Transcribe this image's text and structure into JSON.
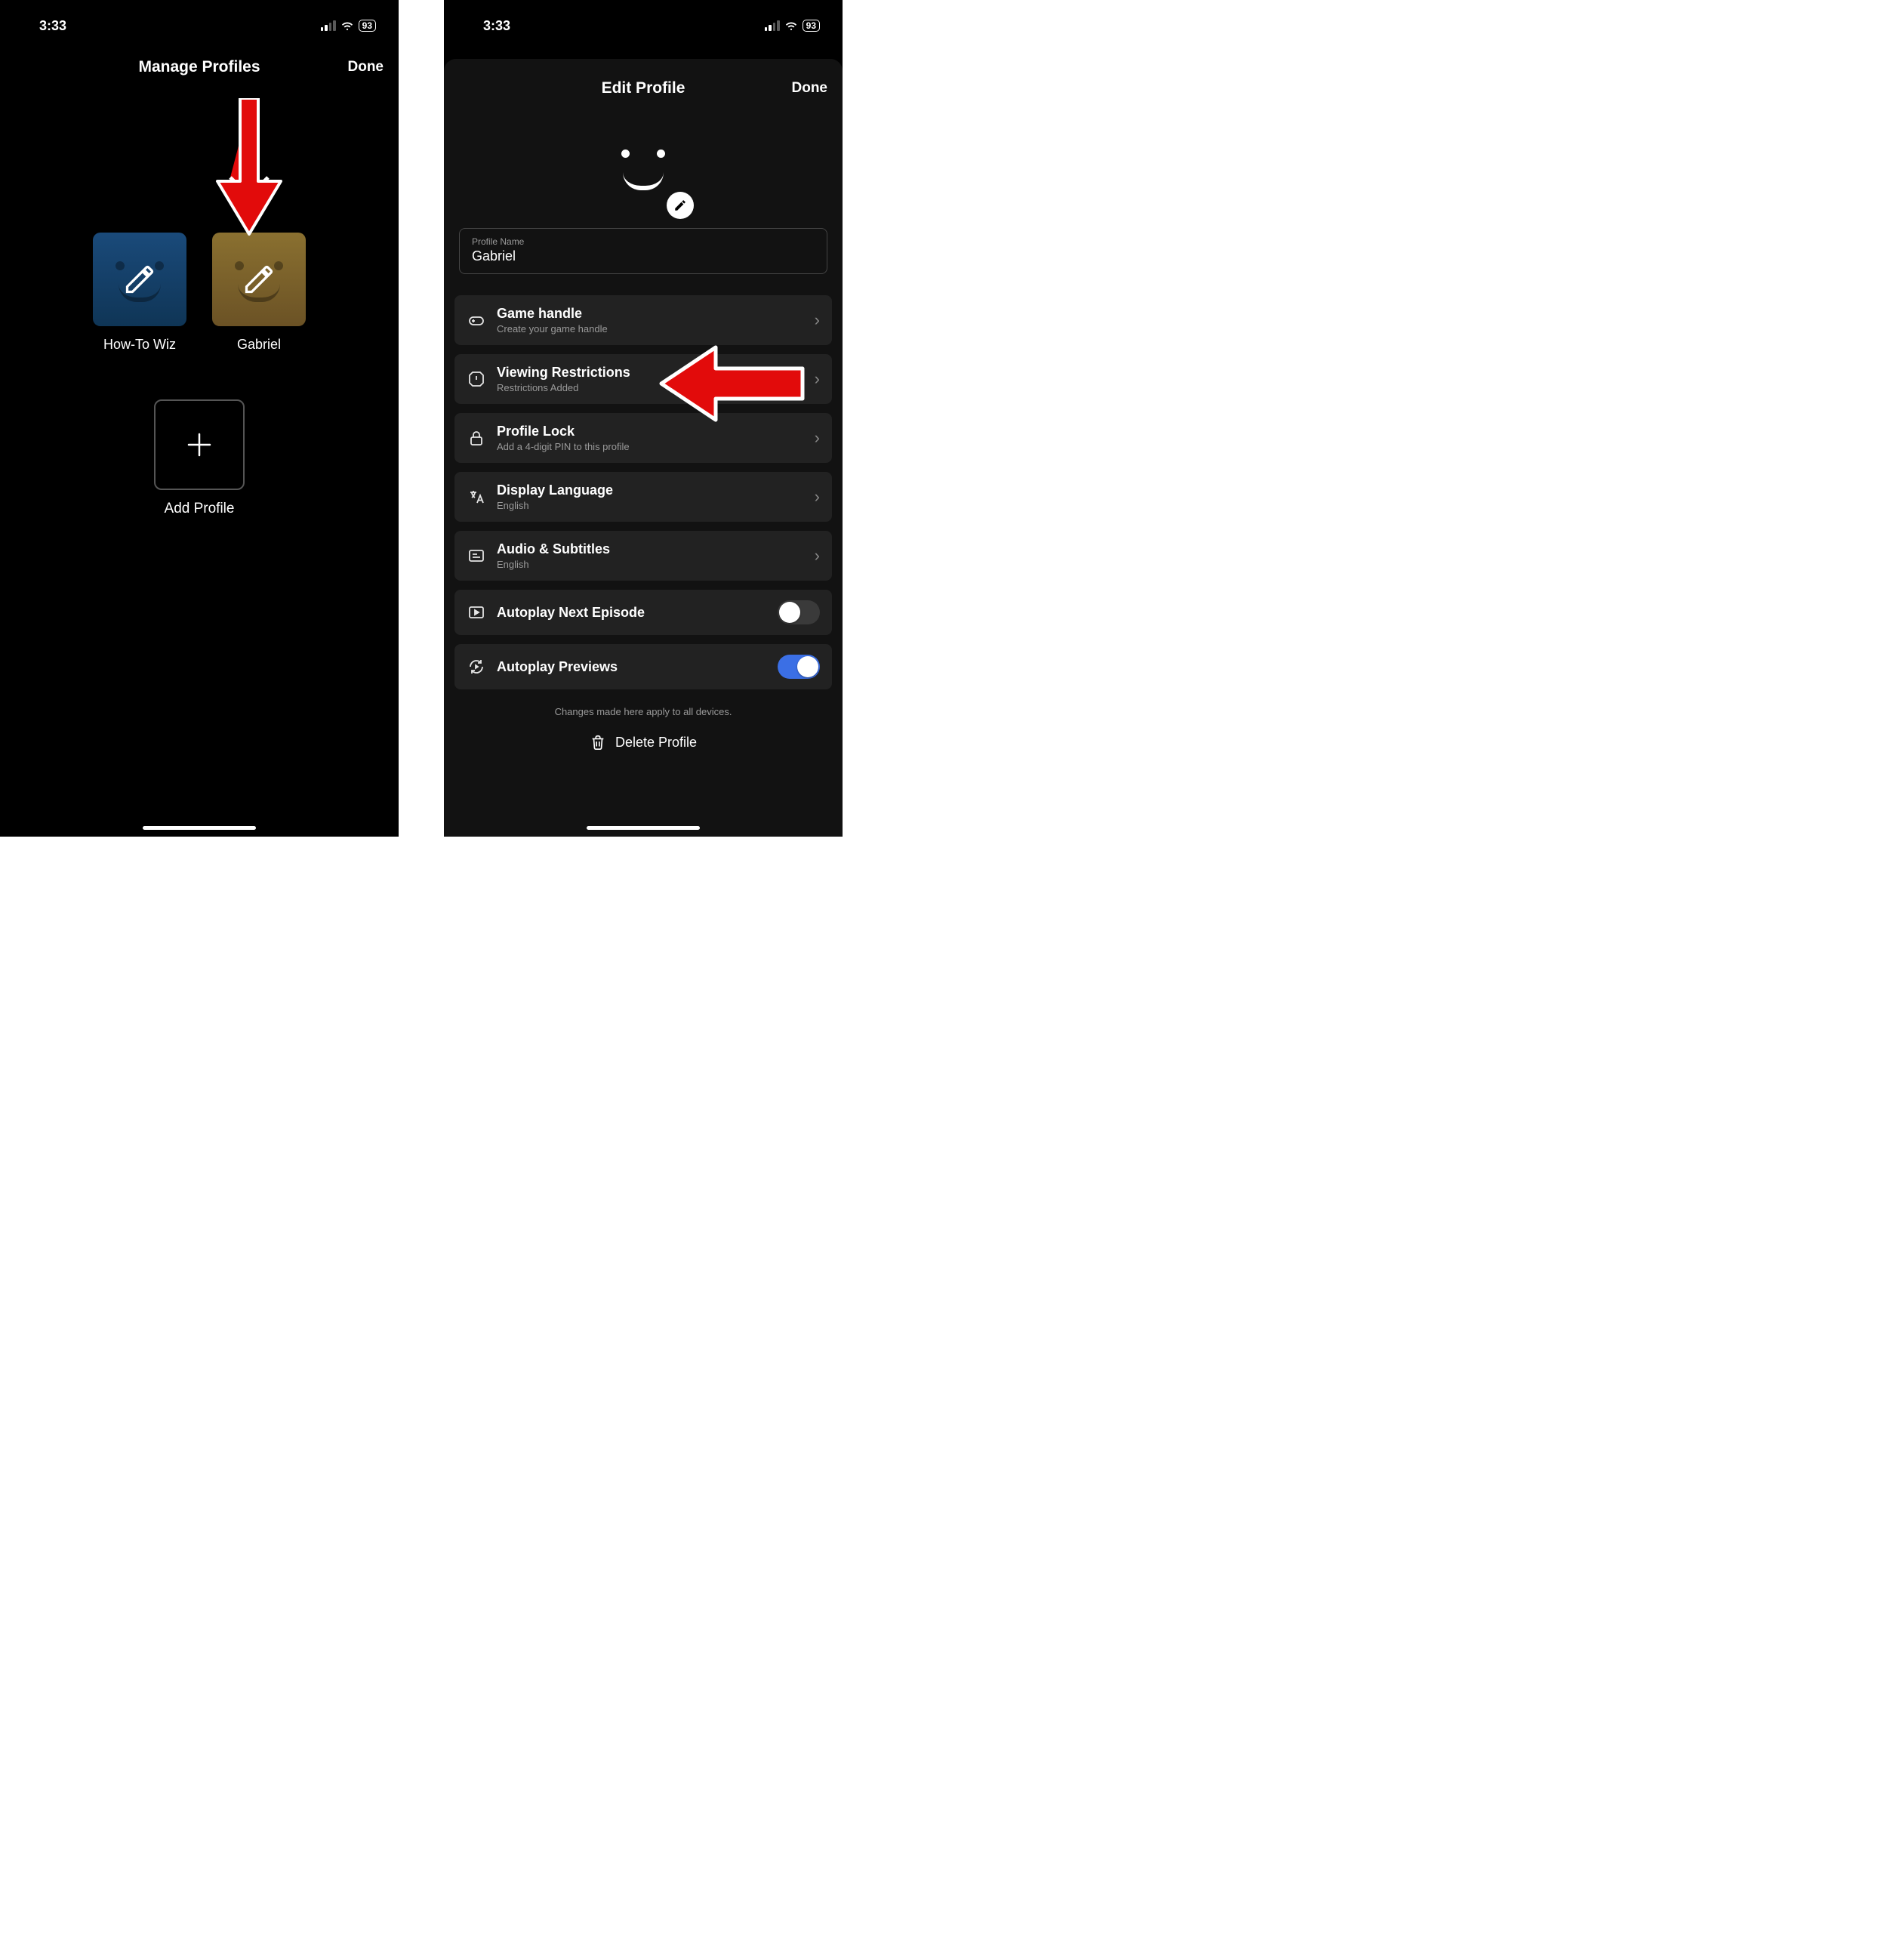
{
  "status": {
    "time": "3:33",
    "battery": "93"
  },
  "left": {
    "title": "Manage Profiles",
    "done": "Done",
    "profiles": [
      {
        "name": "How-To Wiz"
      },
      {
        "name": "Gabriel"
      }
    ],
    "add_label": "Add Profile"
  },
  "right": {
    "title": "Edit Profile",
    "done": "Done",
    "profile_name_label": "Profile Name",
    "profile_name_value": "Gabriel",
    "rows": {
      "game": {
        "title": "Game handle",
        "sub": "Create your game handle"
      },
      "viewing": {
        "title": "Viewing Restrictions",
        "sub": "Restrictions Added"
      },
      "lock": {
        "title": "Profile Lock",
        "sub": "Add a 4-digit PIN to this profile"
      },
      "lang": {
        "title": "Display Language",
        "sub": "English"
      },
      "audio": {
        "title": "Audio & Subtitles",
        "sub": "English"
      },
      "autonext": {
        "title": "Autoplay Next Episode"
      },
      "autoprev": {
        "title": "Autoplay Previews"
      }
    },
    "footer": "Changes made here apply to all devices.",
    "delete": "Delete Profile"
  }
}
